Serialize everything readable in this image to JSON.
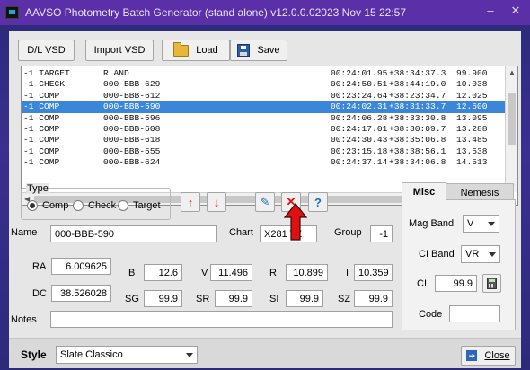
{
  "window": {
    "title": "AAVSO Photometry Batch Generator (stand alone)  v12.0.0.02023 Nov 15 22:57",
    "minimize": "–",
    "close": "✕"
  },
  "toolbar": {
    "dl_vsd": "D/L VSD",
    "import_vsd": "Import VSD",
    "load": "Load",
    "save": "Save"
  },
  "list": {
    "rows": [
      {
        "type": "-1 TARGET",
        "name": "R AND",
        "time": "00:24:01.95",
        "dec": "+38:34:37.3",
        "val": "99.900",
        "selected": false
      },
      {
        "type": "-1 CHECK",
        "name": "000-BBB-629",
        "time": "00:24:50.51",
        "dec": "+38:44:19.0",
        "val": "10.038",
        "selected": false
      },
      {
        "type": "-1 COMP",
        "name": "000-BBB-612",
        "time": "00:23:24.64",
        "dec": "+38:23:34.7",
        "val": "12.025",
        "selected": false
      },
      {
        "type": "-1 COMP",
        "name": "000-BBB-590",
        "time": "00:24:02.31",
        "dec": "+38:31:33.7",
        "val": "12.600",
        "selected": true
      },
      {
        "type": "-1 COMP",
        "name": "000-BBB-596",
        "time": "00:24:06.28",
        "dec": "+38:33:30.8",
        "val": "13.095",
        "selected": false
      },
      {
        "type": "-1 COMP",
        "name": "000-BBB-608",
        "time": "00:24:17.01",
        "dec": "+38:30:09.7",
        "val": "13.288",
        "selected": false
      },
      {
        "type": "-1 COMP",
        "name": "000-BBB-618",
        "time": "00:24:30.43",
        "dec": "+38:35:06.8",
        "val": "13.485",
        "selected": false
      },
      {
        "type": "-1 COMP",
        "name": "000-BBB-555",
        "time": "00:23:15.18",
        "dec": "+38:38:56.1",
        "val": "13.538",
        "selected": false
      },
      {
        "type": "-1 COMP",
        "name": "000-BBB-624",
        "time": "00:24:37.14",
        "dec": "+38:34:06.8",
        "val": "14.513",
        "selected": false
      }
    ]
  },
  "type_group": {
    "label": "Type",
    "options": [
      "Comp",
      "Check",
      "Target"
    ],
    "selected": "Comp"
  },
  "buttons": {
    "move_up": "↑",
    "move_down": "↓",
    "edit": "✎",
    "delete": "✕",
    "info": "?"
  },
  "form": {
    "name_label": "Name",
    "name_value": "000-BBB-590",
    "chart_label": "Chart",
    "chart_value": "X281 TZ",
    "group_label": "Group",
    "group_value": "-1",
    "ra_label": "RA",
    "ra_value": "6.009625",
    "dc_label": "DC",
    "dc_value": "38.526028",
    "b_label": "B",
    "b_value": "12.6",
    "v_label": "V",
    "v_value": "11.496",
    "r_label": "R",
    "r_value": "10.899",
    "i_label": "I",
    "i_value": "10.359",
    "sg_label": "SG",
    "sg_value": "99.9",
    "sr_label": "SR",
    "sr_value": "99.9",
    "si_label": "SI",
    "si_value": "99.9",
    "sz_label": "SZ",
    "sz_value": "99.9",
    "notes_label": "Notes",
    "notes_value": ""
  },
  "tabs": {
    "misc": "Misc",
    "nemesis": "Nemesis"
  },
  "misc": {
    "mag_band_label": "Mag Band",
    "mag_band_value": "V",
    "ci_band_label": "CI Band",
    "ci_band_value": "VR",
    "ci_label": "CI",
    "ci_value": "99.9",
    "code_label": "Code",
    "code_value": ""
  },
  "footer": {
    "style_label": "Style",
    "style_value": "Slate Classico",
    "close_label": "Close"
  },
  "colors": {
    "selection": "#3b86d8",
    "title_bar": "#5b2fa8",
    "annotation_arrow": "#e01010"
  }
}
